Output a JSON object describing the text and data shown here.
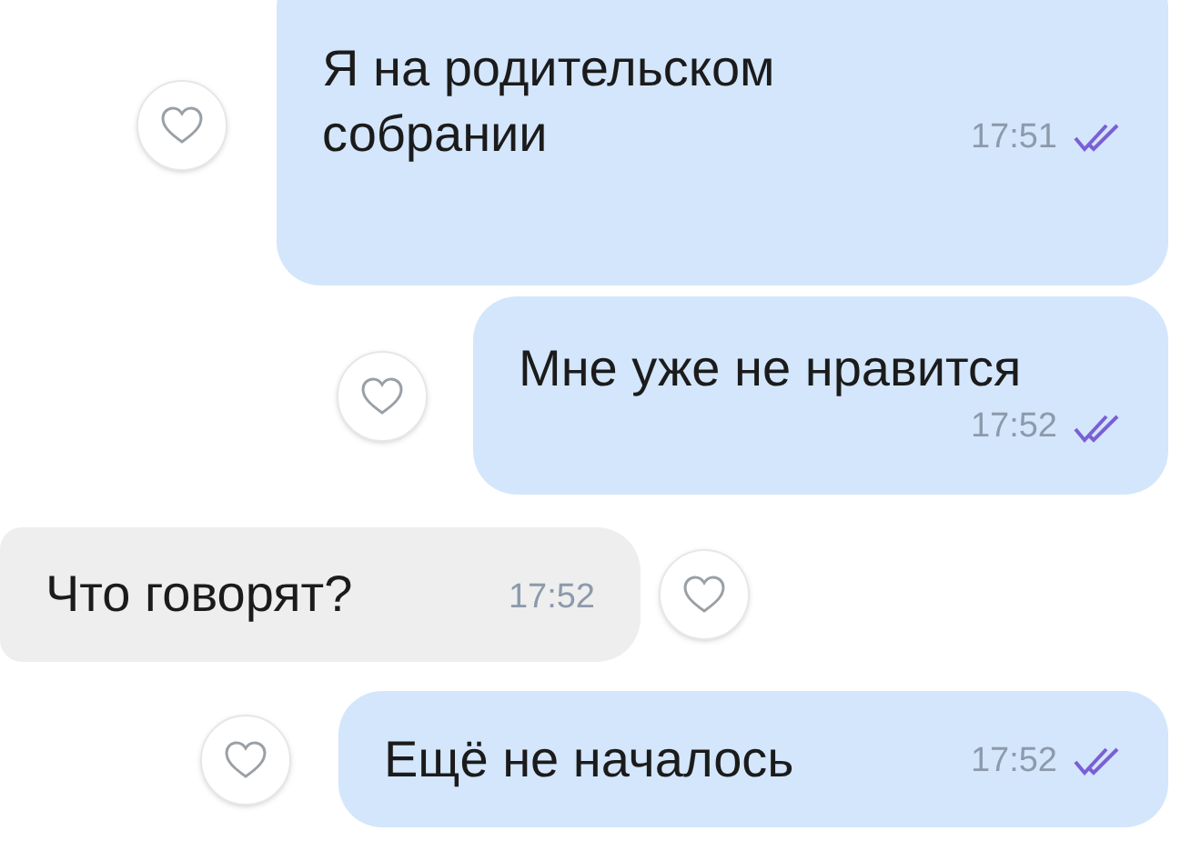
{
  "messages": [
    {
      "kind": "out",
      "text": "Я на родительском собрании",
      "time": "17:51",
      "read": true,
      "liked": false
    },
    {
      "kind": "out",
      "text": "Мне уже не нравится",
      "time": "17:52",
      "read": true,
      "liked": false
    },
    {
      "kind": "in",
      "text": "Что говорят?",
      "time": "17:52",
      "liked": false
    },
    {
      "kind": "out",
      "text": "Ещё не началось",
      "time": "17:52",
      "read": true,
      "liked": false
    }
  ]
}
